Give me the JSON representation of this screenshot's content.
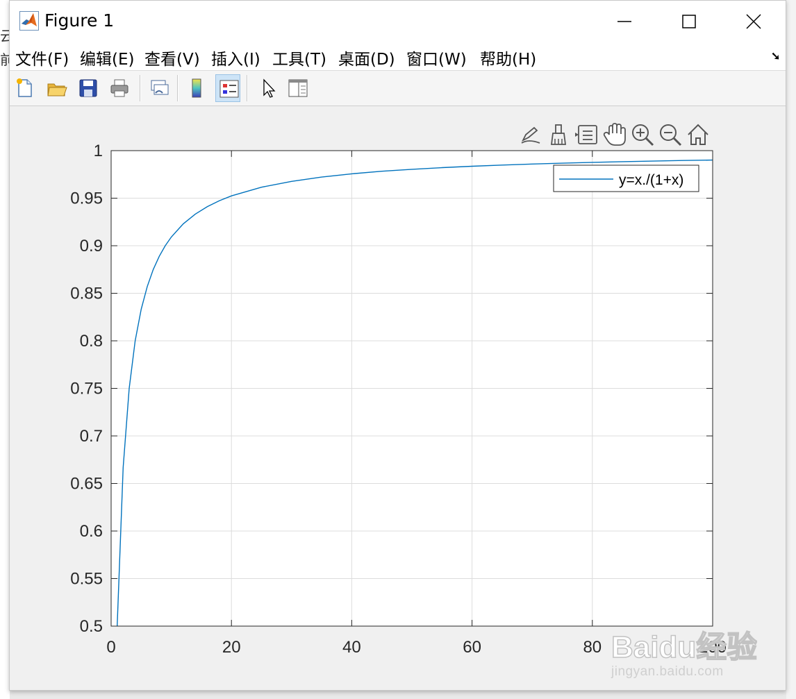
{
  "window": {
    "title": "Figure 1"
  },
  "menu": [
    {
      "label": "文件(F)"
    },
    {
      "label": "编辑(E)"
    },
    {
      "label": "查看(V)"
    },
    {
      "label": "插入(I)"
    },
    {
      "label": "工具(T)"
    },
    {
      "label": "桌面(D)"
    },
    {
      "label": "窗口(W)"
    },
    {
      "label": "帮助(H)"
    }
  ],
  "toolbar_icons": [
    "new-figure-icon",
    "open-file-icon",
    "save-icon",
    "print-icon",
    "link-plot-icon",
    "colorbar-icon",
    "legend-icon",
    "edit-plot-icon",
    "property-inspector-icon"
  ],
  "axes_toolbar_icons": [
    "brush-edit-icon",
    "data-brush-icon",
    "data-tips-icon",
    "pan-icon",
    "zoom-in-icon",
    "zoom-out-icon",
    "restore-view-icon"
  ],
  "background": {
    "left_glyphs": [
      "云",
      "前"
    ]
  },
  "watermark": {
    "logo": "Baidu经验",
    "url": "jingyan.baidu.com"
  },
  "colors": {
    "line": "#0072bd",
    "grid": "#dcdcdc",
    "axes_bg": "#ffffff",
    "figure_bg": "#f0f0f0"
  },
  "chart_data": {
    "type": "line",
    "title": "",
    "xlabel": "",
    "ylabel": "",
    "xlim": [
      0,
      100
    ],
    "ylim": [
      0.5,
      1
    ],
    "xticks": [
      0,
      20,
      40,
      60,
      80,
      100
    ],
    "yticks": [
      0.5,
      0.55,
      0.6,
      0.65,
      0.7,
      0.75,
      0.8,
      0.85,
      0.9,
      0.95,
      1
    ],
    "grid": true,
    "legend_location": "top-right",
    "series": [
      {
        "name": "y=x./(1+x)",
        "color": "#0072bd",
        "x": [
          1,
          2,
          3,
          4,
          5,
          6,
          7,
          8,
          9,
          10,
          12,
          14,
          16,
          18,
          20,
          25,
          30,
          35,
          40,
          45,
          50,
          55,
          60,
          65,
          70,
          75,
          80,
          85,
          90,
          95,
          100
        ],
        "y": [
          0.5,
          0.6667,
          0.75,
          0.8,
          0.8333,
          0.8571,
          0.875,
          0.8889,
          0.9,
          0.9091,
          0.9231,
          0.9333,
          0.9412,
          0.9474,
          0.9524,
          0.9615,
          0.9677,
          0.9722,
          0.9756,
          0.9783,
          0.9804,
          0.9821,
          0.9836,
          0.9848,
          0.9859,
          0.9868,
          0.9877,
          0.9884,
          0.989,
          0.9896,
          0.9901
        ]
      }
    ]
  }
}
